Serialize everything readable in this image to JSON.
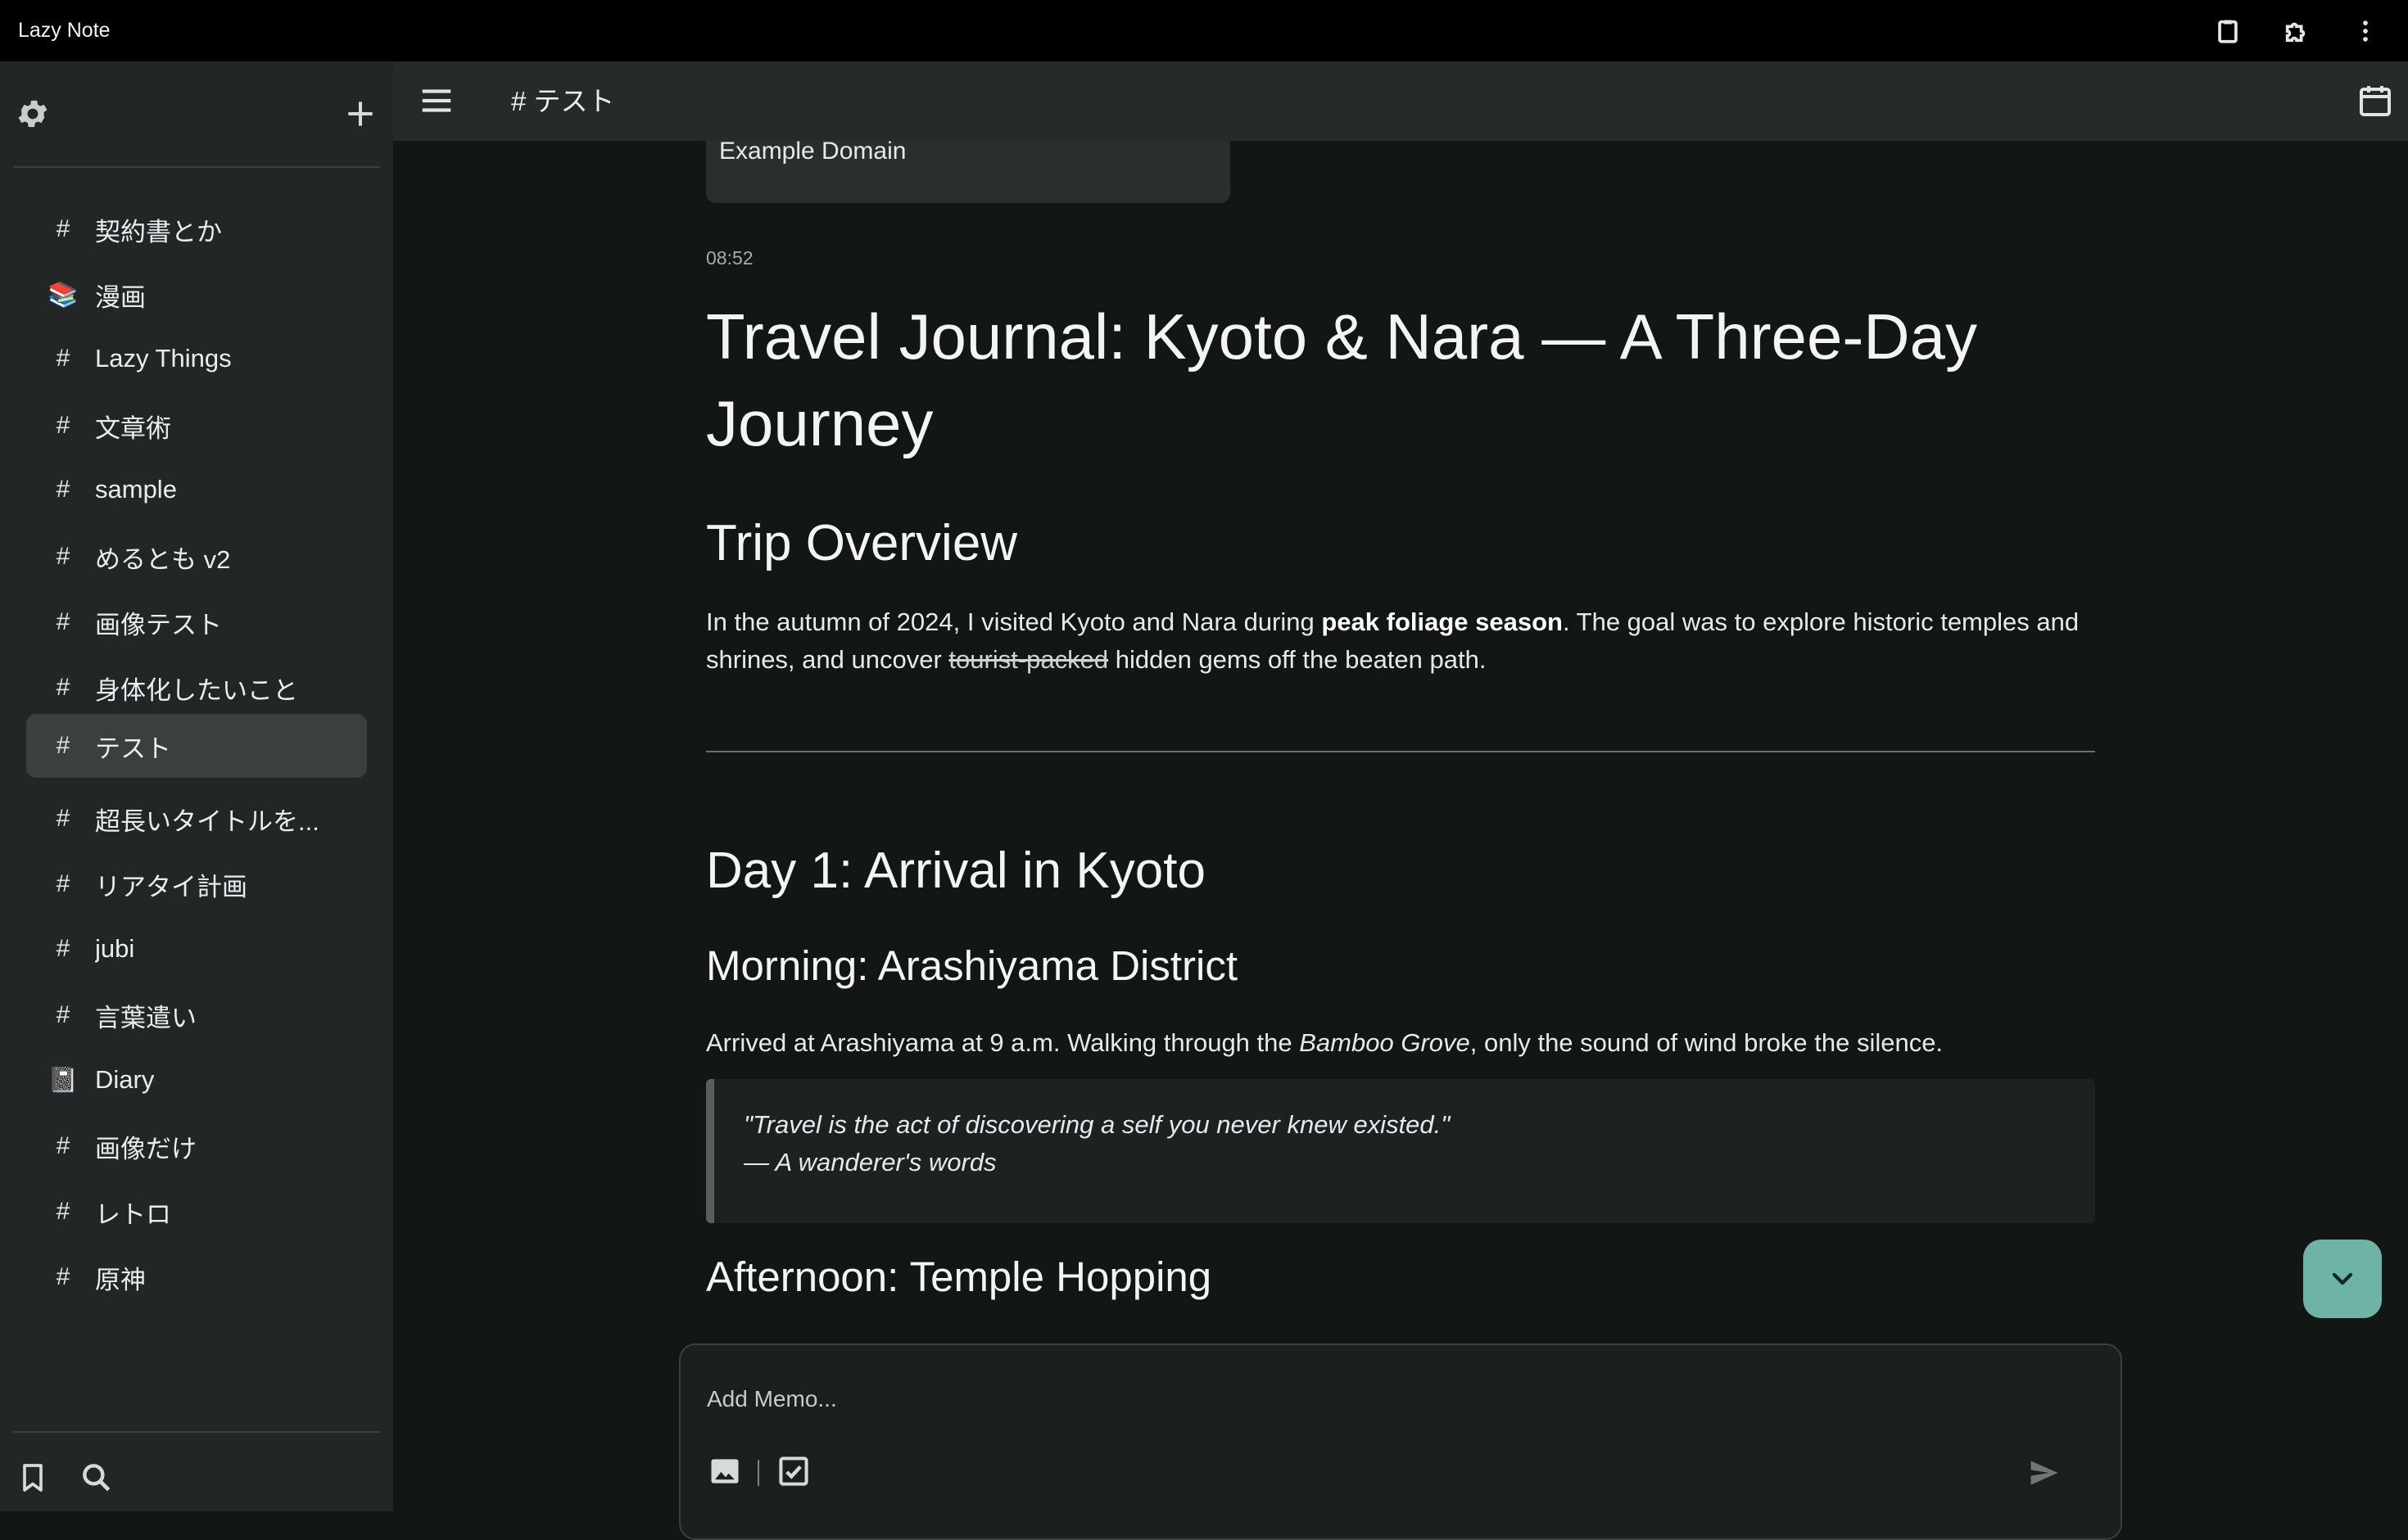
{
  "window": {
    "app_title": "Lazy Note",
    "icons": [
      "clipboard-icon",
      "extension-icon",
      "more-vert-icon"
    ]
  },
  "sidebar": {
    "top_icons": [
      "settings-icon",
      "add-icon"
    ],
    "items": [
      {
        "symbol": "#",
        "label": "契約書とか"
      },
      {
        "symbol": "📚",
        "label": "漫画"
      },
      {
        "symbol": "#",
        "label": "Lazy Things"
      },
      {
        "symbol": "#",
        "label": "文章術"
      },
      {
        "symbol": "#",
        "label": "sample"
      },
      {
        "symbol": "#",
        "label": "めるとも v2"
      },
      {
        "symbol": "#",
        "label": "画像テスト"
      },
      {
        "symbol": "#",
        "label": "身体化したいこと"
      },
      {
        "symbol": "#",
        "label": "テスト",
        "active": true
      },
      {
        "symbol": "#",
        "label": "超長いタイトルを..."
      },
      {
        "symbol": "#",
        "label": "リアタイ計画"
      },
      {
        "symbol": "#",
        "label": "jubi"
      },
      {
        "symbol": "#",
        "label": "言葉遣い"
      },
      {
        "symbol": "📓",
        "label": "Diary"
      },
      {
        "symbol": "#",
        "label": "画像だけ"
      },
      {
        "symbol": "#",
        "label": "レトロ"
      },
      {
        "symbol": "#",
        "label": "原神"
      }
    ],
    "bottom_icons": [
      "bookmark-icon",
      "search-icon"
    ]
  },
  "header": {
    "breadcrumb": "# テスト",
    "icons": [
      "menu-icon",
      "calendar-icon"
    ]
  },
  "note": {
    "link_card_title": "Example Domain",
    "time": "08:52",
    "title": "Travel Journal: Kyoto & Nara — A Three-Day Journey",
    "overview_heading": "Trip Overview",
    "overview": {
      "part1": "In the autumn of 2024, I visited Kyoto and Nara during ",
      "bold": "peak foliage season",
      "part2": ". The goal was to explore historic temples and shrines, and uncover ",
      "strike": "tourist-packed",
      "part3": " hidden gems off the beaten path."
    },
    "day1_heading": "Day 1: Arrival in Kyoto",
    "morning_heading": "Morning: Arashiyama District",
    "morning": {
      "part1": "Arrived at Arashiyama at 9 a.m. Walking through the ",
      "italic": "Bamboo Grove",
      "part2": ", only the sound of wind broke the silence."
    },
    "quote_line1": "\"Travel is the act of discovering a self you never knew existed.\"",
    "quote_line2": "— A wanderer's words",
    "afternoon_heading": "Afternoon: Temple Hopping"
  },
  "composer": {
    "placeholder": "Add Memo...",
    "icons": [
      "image-icon",
      "checkbox-icon",
      "send-icon"
    ]
  },
  "colors": {
    "titlebar": "#000000",
    "sidebar": "#222726",
    "header": "#252b2a",
    "background": "#121614",
    "fab": "#6fb3a7"
  }
}
